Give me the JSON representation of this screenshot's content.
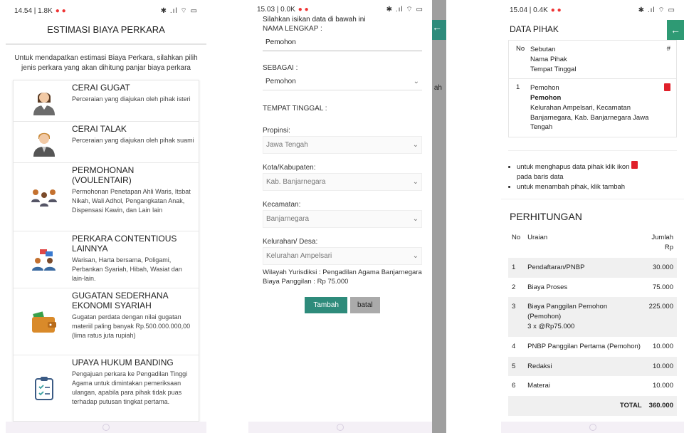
{
  "screen1": {
    "status": {
      "time": "14.54 | 1.8K",
      "icons_right": "✱ .ıl ☆"
    },
    "title": "ESTIMASI BIAYA PERKARA",
    "intro": "Untuk mendapatkan estimasi Biaya Perkara, silahkan pilih jenis perkara yang akan dihitung panjar biaya perkara",
    "cases": [
      {
        "title": "CERAI GUGAT",
        "desc": "Perceraian yang diajukan oleh pihak isteri",
        "icon": "woman-avatar-icon"
      },
      {
        "title": "CERAI TALAK",
        "desc": "Perceraian yang diajukan oleh pihak suami",
        "icon": "man-avatar-icon"
      },
      {
        "title": "PERMOHONAN (VOULENTAIR)",
        "desc": "Permohonan Penetapan Ahli Waris, Itsbat Nikah, Wali Adhol, Pengangkatan Anak, Dispensasi Kawin, dan Lain lain",
        "icon": "group-icon"
      },
      {
        "title": "PERKARA CONTENTIOUS LAINNYA",
        "desc": "Warisan, Harta bersama, Poligami, Perbankan Syariah, Hibah, Wasiat dan lain-lain.",
        "icon": "dispute-icon"
      },
      {
        "title": "GUGATAN SEDERHANA EKONOMI SYARIAH",
        "desc": "Gugatan perdata dengan nilai gugatan materiil paling banyak Rp.500.000.000,00 (lima ratus juta rupiah)",
        "icon": "wallet-icon"
      },
      {
        "title": "UPAYA HUKUM BANDING",
        "desc": "Pengajuan perkara ke Pengadilan Tinggi Agama untuk dimintakan pemeriksaan ulangan, apabila para pihak tidak puas terhadap putusan tingkat pertama.",
        "icon": "clipboard-icon"
      }
    ]
  },
  "screen2": {
    "status": {
      "time": "15.03 | 0.0K"
    },
    "header_text": "Silahkan isikan data di bawah ini",
    "side_text": "ah",
    "nama_label": "NAMA LENGKAP :",
    "nama_value": "Pemohon",
    "sebagai_label": "SEBAGAI :",
    "sebagai_value": "Pemohon",
    "tempat_label": "TEMPAT TINGGAL :",
    "propinsi_label": "Propinsi:",
    "propinsi_value": "Jawa Tengah",
    "kota_label": "Kota/Kabupaten:",
    "kota_value": "Kab. Banjarnegara",
    "kec_label": "Kecamatan:",
    "kec_value": "Banjarnegara",
    "kel_label": "Kelurahan/ Desa:",
    "kel_value": "Kelurahan Ampelsari",
    "info": "Wilayah Yurisdiksi : Pengadilan Agama Banjarnegara",
    "biaya": "Biaya Panggilan : Rp 75.000",
    "btn_tambah": "Tambah",
    "btn_batal": "batal"
  },
  "screen3": {
    "status": {
      "time": "15.04 | 0.4K"
    },
    "data_pihak": "DATA PIHAK",
    "pihak_head": {
      "no": "No",
      "sebutan": "Sebutan",
      "nama": "Nama Pihak",
      "tempat": "Tempat Tinggal",
      "hash": "#"
    },
    "pihak_row": {
      "no": "1",
      "sebutan": "Pemohon",
      "nama": "Pemohon",
      "alamat": "Kelurahan Ampelsari, Kecamatan Banjarnegara, Kab. Banjarnegara Jawa Tengah"
    },
    "note1": "untuk menghapus data pihak klik ikon",
    "note1b": "pada baris data",
    "note2": "untuk menambah pihak, klik tambah",
    "perhitungan": "PERHITUNGAN",
    "table_head": {
      "no": "No",
      "uraian": "Uraian",
      "jumlah": "Jumlah",
      "rp": "Rp"
    },
    "rows": [
      {
        "no": "1",
        "uraian": "Pendaftaran/PNBP",
        "jumlah": "30.000"
      },
      {
        "no": "2",
        "uraian": "Biaya Proses",
        "jumlah": "75.000"
      },
      {
        "no": "3",
        "uraian": "Biaya Panggilan Pemohon (Pemohon)",
        "sub": "3 x @Rp75.000",
        "jumlah": "225.000"
      },
      {
        "no": "4",
        "uraian": "PNBP Panggilan Pertama (Pemohon)",
        "jumlah": "10.000"
      },
      {
        "no": "5",
        "uraian": "Redaksi",
        "jumlah": "10.000"
      },
      {
        "no": "6",
        "uraian": "Materai",
        "jumlah": "10.000"
      }
    ],
    "total_label": "TOTAL",
    "total_value": "360.000"
  }
}
